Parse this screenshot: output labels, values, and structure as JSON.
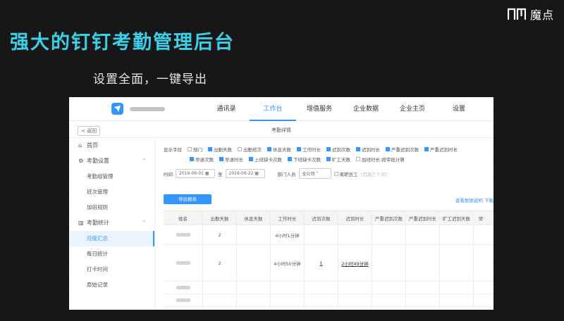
{
  "brand": {
    "name": "魔点",
    "logo": "nm-logo-icon"
  },
  "headline": "强大的钉钉考勤管理后台",
  "subline": "设置全面，一键导出",
  "app": {
    "nav": [
      "通讯录",
      "工作台",
      "增值服务",
      "企业数据",
      "企业主页",
      "设置"
    ],
    "active_nav": "工作台",
    "back_label": "返回",
    "page_title": "考勤详情",
    "sidebar": [
      {
        "label": "首页",
        "icon": "home-icon"
      },
      {
        "label": "考勤设置",
        "icon": "gear-icon",
        "chev": "^"
      },
      {
        "label": "考勤组管理"
      },
      {
        "label": "班次管理"
      },
      {
        "label": "加班规则"
      },
      {
        "label": "考勤统计",
        "icon": "chart-icon",
        "chev": "^"
      },
      {
        "label": "月度汇总"
      },
      {
        "label": "每日统计"
      },
      {
        "label": "打卡时间"
      },
      {
        "label": "原始记录"
      }
    ],
    "filters": {
      "label": "显示字段",
      "row1": [
        {
          "label": "部门",
          "on": false
        },
        {
          "label": "出勤天数",
          "on": true
        },
        {
          "label": "出勤班次",
          "on": false
        },
        {
          "label": "休息天数",
          "on": true
        },
        {
          "label": "工作时长",
          "on": true
        },
        {
          "label": "迟到次数",
          "on": true
        },
        {
          "label": "迟到时长",
          "on": true
        },
        {
          "label": "严重迟到次数",
          "on": true
        },
        {
          "label": "严重迟到时长",
          "on": true
        }
      ],
      "row2": [
        {
          "label": "早退次数",
          "on": true
        },
        {
          "label": "早退时长",
          "on": true
        },
        {
          "label": "上班缺卡次数",
          "on": true
        },
        {
          "label": "下班缺卡次数",
          "on": true
        },
        {
          "label": "旷工天数",
          "on": true
        },
        {
          "label": "加班时长-按审批计算",
          "on": false
        }
      ],
      "time_label": "时间",
      "date_from": "2016-06-01",
      "to_label": "至",
      "date_to": "2016-06-22",
      "dept_label": "部门人员",
      "dept_value": "全公司",
      "resigned_label": "离职员工",
      "range_hint": "(范围三个月)"
    },
    "export_label": "导出报表",
    "links": "查看数据说明  下载",
    "table": {
      "headers": [
        "姓名",
        "出勤天数",
        "休息天数",
        "工作时长",
        "迟到次数",
        "迟到时长",
        "严重迟到次数",
        "严重迟到时长",
        "旷工迟到天数",
        "早"
      ],
      "rows": [
        [
          "",
          "2",
          "-",
          "4小时1分钟",
          "-",
          "-",
          "-",
          "-",
          "-",
          "-"
        ],
        [
          "",
          "2",
          "-",
          "4小时50分钟",
          "1",
          "2小时49分钟",
          "-",
          "-",
          "-",
          "-"
        ],
        [
          "",
          "-",
          "-",
          "-",
          "-",
          "-",
          "-",
          "-",
          "-",
          "-"
        ],
        [
          "",
          "-",
          "-",
          "-",
          "-",
          "-",
          "-",
          "-",
          "-",
          "-"
        ]
      ]
    }
  }
}
